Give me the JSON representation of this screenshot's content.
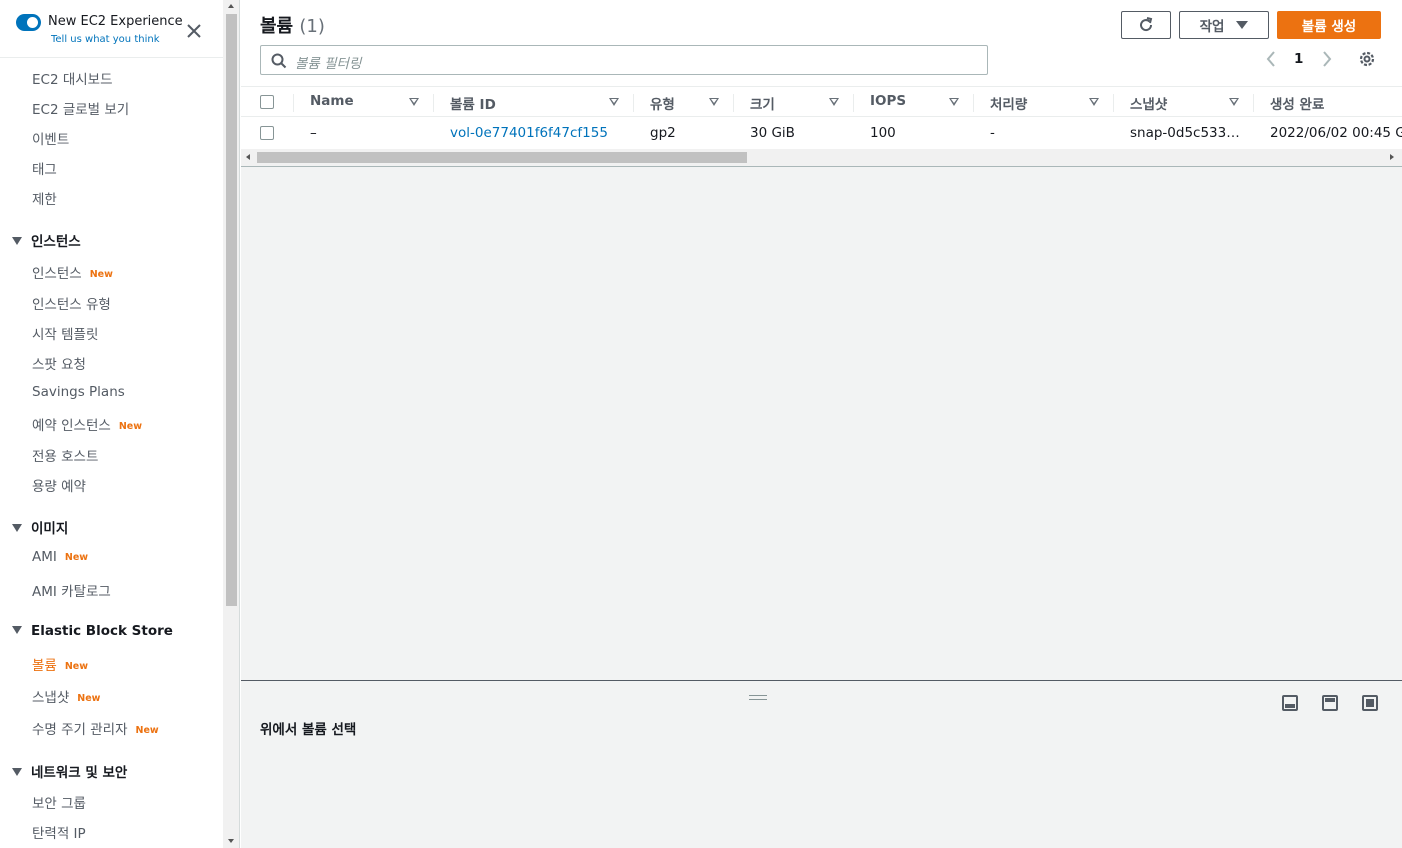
{
  "experience": {
    "title": "New EC2 Experience",
    "feedback_link": "Tell us what you think"
  },
  "sidebar": {
    "top_items": [
      "EC2 대시보드",
      "EC2 글로벌 보기",
      "이벤트",
      "태그",
      "제한"
    ],
    "sections": [
      {
        "label": "인스턴스",
        "items": [
          {
            "label": "인스턴스",
            "badge": "New"
          },
          {
            "label": "인스턴스 유형"
          },
          {
            "label": "시작 템플릿"
          },
          {
            "label": "스팟 요청"
          },
          {
            "label": "Savings Plans"
          },
          {
            "label": "예약 인스턴스",
            "badge": "New"
          },
          {
            "label": "전용 호스트"
          },
          {
            "label": "용량 예약"
          }
        ]
      },
      {
        "label": "이미지",
        "items": [
          {
            "label": "AMI",
            "badge": "New"
          },
          {
            "label": "AMI 카탈로그"
          }
        ]
      },
      {
        "label": "Elastic Block Store",
        "items": [
          {
            "label": "볼륨",
            "badge": "New",
            "active": true
          },
          {
            "label": "스냅샷",
            "badge": "New"
          },
          {
            "label": "수명 주기 관리자",
            "badge": "New"
          }
        ]
      },
      {
        "label": "네트워크 및 보안",
        "items": [
          {
            "label": "보안 그룹"
          },
          {
            "label": "탄력적 IP"
          }
        ]
      }
    ]
  },
  "header": {
    "title": "볼륨",
    "count": "(1)",
    "actions_label": "작업",
    "create_label": "볼륨 생성"
  },
  "search": {
    "placeholder": "볼륨 필터링"
  },
  "pagination": {
    "current_page": "1"
  },
  "table": {
    "columns": [
      "Name",
      "볼륨 ID",
      "유형",
      "크기",
      "IOPS",
      "처리량",
      "스냅샷",
      "생성 완료"
    ],
    "rows": [
      [
        "–",
        "vol-0e77401f6f47cf155",
        "gp2",
        "30 GiB",
        "100",
        "-",
        "snap-0d5c533…",
        "2022/06/02 00:45 G"
      ]
    ]
  },
  "split_panel": {
    "title": "위에서 볼륨 선택"
  },
  "colors": {
    "accent": "#ec7211",
    "link": "#0073bb",
    "text": "#16191f",
    "muted": "#545b64"
  }
}
